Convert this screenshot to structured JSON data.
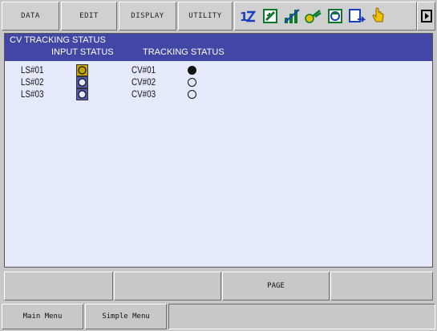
{
  "menu": {
    "data_label": "DATA",
    "edit_label": "EDIT",
    "display_label": "DISPLAY",
    "utility_label": "UTILITY"
  },
  "status_icons": [
    "axis-12-icon",
    "edit-mode-icon",
    "signal-bars-icon",
    "tool-icon",
    "teach-icon",
    "cycle-icon",
    "hand-pointer-icon"
  ],
  "screen": {
    "title": "CV TRACKING STATUS",
    "input_header": "INPUT STATUS",
    "tracking_header": "TRACKING STATUS",
    "rows": [
      {
        "ls": "LS#01",
        "input_active": true,
        "cv": "CV#01",
        "tracking_on": true
      },
      {
        "ls": "LS#02",
        "input_active": false,
        "cv": "CV#02",
        "tracking_on": false
      },
      {
        "ls": "LS#03",
        "input_active": false,
        "cv": "CV#03",
        "tracking_on": false
      }
    ]
  },
  "function_keys": [
    "",
    "",
    "PAGE",
    ""
  ],
  "bottom_menu": {
    "main_menu_label": "Main Menu",
    "simple_menu_label": "Simple Menu"
  },
  "colors": {
    "title_bar": "#4247a6",
    "panel_bg": "#e6e8fb",
    "indicator_active": "#c7a500",
    "indicator_inactive": "#5358b3"
  }
}
